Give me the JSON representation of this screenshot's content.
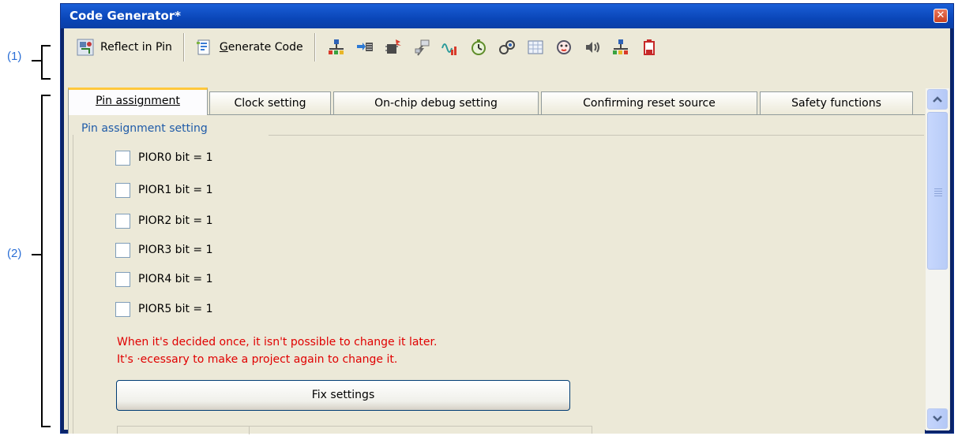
{
  "callouts": {
    "one": "(1)",
    "two": "(2)"
  },
  "window": {
    "title": "Code Generator*",
    "close_glyph": "✕"
  },
  "toolbar": {
    "reflect_label": "Reflect in Pin",
    "generate_label_prefix": "",
    "generate_label_underline": "G",
    "generate_label_rest": "enerate Code",
    "icons": [
      "port-icon",
      "serial-icon",
      "chip-icon",
      "interrupt-icon",
      "analog-icon",
      "timer-icon",
      "link-icon",
      "grid-icon",
      "watchdog-icon",
      "sound-icon",
      "network-icon",
      "battery-icon"
    ]
  },
  "tabs": [
    {
      "label": "Pin assignment"
    },
    {
      "label": "Clock setting"
    },
    {
      "label": "On-chip debug setting"
    },
    {
      "label": "Confirming reset source"
    },
    {
      "label": "Safety functions"
    }
  ],
  "group": {
    "legend": "Pin assignment setting"
  },
  "checkboxes": [
    {
      "label": "PIOR0 bit = 1",
      "checked": false
    },
    {
      "label": "PIOR1 bit = 1",
      "checked": false
    },
    {
      "label": "PIOR2 bit = 1",
      "checked": false
    },
    {
      "label": "PIOR3 bit = 1",
      "checked": false
    },
    {
      "label": "PIOR4 bit = 1",
      "checked": false
    },
    {
      "label": "PIOR5 bit = 1",
      "checked": false
    }
  ],
  "warning": {
    "line1": "When it's decided once, it isn't possible to change it later.",
    "line2": "It's ·ecessary to make a project again to change it."
  },
  "fix_button": {
    "label": "Fix settings"
  },
  "colors": {
    "title_bar": "#0a46b8",
    "warning": "#e00000",
    "legend": "#1f5ba8",
    "tab_highlight": "#ffc83c"
  }
}
